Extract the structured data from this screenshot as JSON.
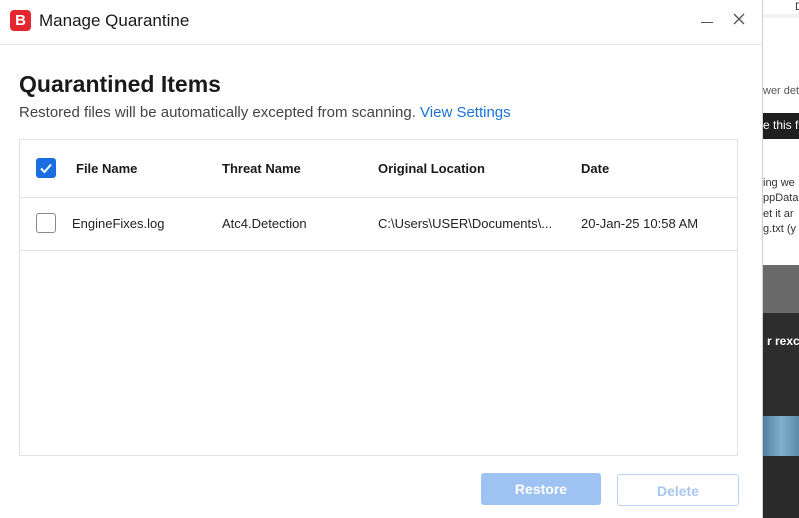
{
  "window": {
    "title": "Manage Quarantine",
    "logo_letter": "B",
    "accent_color": "#e3262f"
  },
  "page": {
    "heading": "Quarantined Items",
    "subtitle": "Restored files will be automatically excepted from scanning.",
    "settings_link": "View Settings"
  },
  "table": {
    "columns": [
      "File Name",
      "Threat Name",
      "Original Location",
      "Date"
    ],
    "header_checkbox_checked": true,
    "rows": [
      {
        "checked": false,
        "file_name": "EngineFixes.log",
        "threat_name": "Atc4.Detection",
        "original_location": "C:\\Users\\USER\\Documents\\...",
        "date": "20-Jan-25 10:58 AM"
      }
    ]
  },
  "actions": {
    "restore_label": "Restore",
    "delete_label": "Delete"
  },
  "background_window": {
    "fragments": [
      "D",
      "wer det",
      "e this f",
      "ing we",
      "ppData",
      "et it ar",
      "g.txt (y",
      "r rexcl"
    ]
  }
}
